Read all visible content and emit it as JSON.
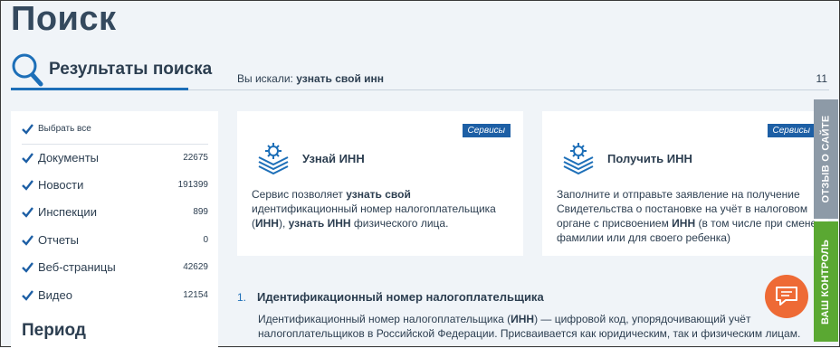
{
  "page": {
    "title": "Поиск"
  },
  "results_header": {
    "label": "Результаты поиска",
    "searched_prefix": "Вы искали:",
    "query": "узнать свой инн",
    "count": "11"
  },
  "sidebar": {
    "select_all": "Выбрать все",
    "filters": [
      {
        "label": "Документы",
        "count": "22675"
      },
      {
        "label": "Новости",
        "count": "191399"
      },
      {
        "label": "Инспекции",
        "count": "899"
      },
      {
        "label": "Отчеты",
        "count": "0"
      },
      {
        "label": "Веб-страницы",
        "count": "42629"
      },
      {
        "label": "Видео",
        "count": "12154"
      }
    ],
    "period_heading": "Период"
  },
  "cards": [
    {
      "badge": "Сервисы",
      "title": "Узнай ИНН",
      "desc": [
        "Сервис позволяет ",
        "узнать свой",
        " идентификационный номер налогоплательщика (",
        "ИНН",
        "), ",
        "узнать ИНН",
        " физического лица."
      ]
    },
    {
      "badge": "Сервисы",
      "title": "Получить ИНН",
      "desc": [
        "Заполните и отправьте заявление на получение Свидетельства о постановке на учёт в налоговом органе с присвоением ",
        "ИНН",
        " (в том числе при смене фамилии или для своего ребенка)"
      ]
    }
  ],
  "result": {
    "number": "1.",
    "title": "Идентификационный номер налогоплательщика",
    "text_parts": [
      "Идентификационный номер налогоплательщика (",
      "ИНН",
      ") — цифровой код, упорядочивающий учёт налогоплательщиков в Российской Федерации. Присваивается как юридическим, так и физическим лицам."
    ]
  },
  "side_tabs": {
    "feedback": "ОТЗЫВ О САЙТЕ",
    "control": "ВАШ КОНТРОЛЬ"
  },
  "colors": {
    "accent": "#1d6fb8",
    "badge": "#1d5fa5",
    "chat": "#ee6a35",
    "control_tab": "#5aa832",
    "feedback_tab": "#8d9aa7"
  },
  "icons": {
    "search": "search-icon",
    "checkbox": "checkbox-checked-icon",
    "service": "gear-stack-icon",
    "chat": "chat-icon"
  }
}
